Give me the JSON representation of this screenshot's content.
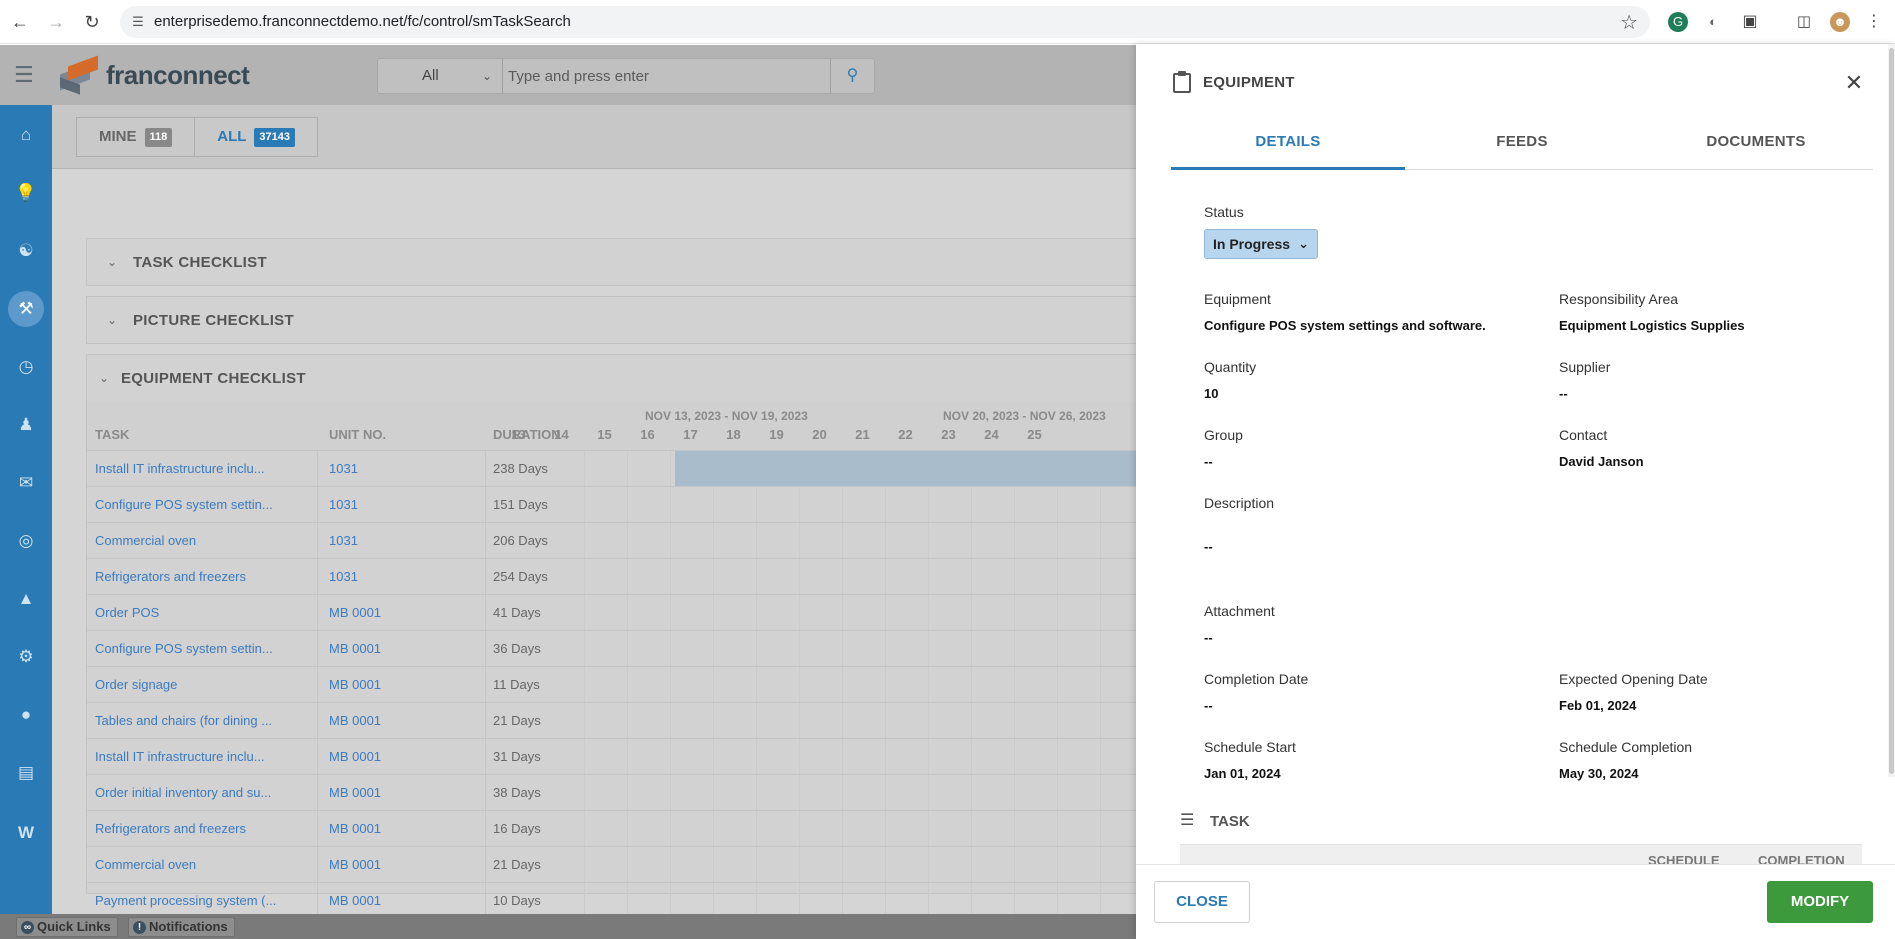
{
  "browser": {
    "url": "enterprisedemo.franconnectdemo.net/fc/control/smTaskSearch"
  },
  "app": {
    "logo_text": "franconnect",
    "search": {
      "scope": "All",
      "placeholder": "Type and press enter"
    },
    "filter_tabs": [
      {
        "label": "MINE",
        "count": "118"
      },
      {
        "label": "ALL",
        "count": "37143"
      }
    ],
    "sections": {
      "task_checklist": "TASK CHECKLIST",
      "picture_checklist": "PICTURE CHECKLIST",
      "equipment_checklist": "EQUIPMENT CHECKLIST"
    },
    "grid": {
      "columns": {
        "task": "TASK",
        "unit": "UNIT NO.",
        "duration": "DURATION"
      },
      "weeks": [
        "NOV 13, 2023 - NOV 19, 2023",
        "NOV 20, 2023 - NOV 26, 2023"
      ],
      "days": [
        "13",
        "14",
        "15",
        "16",
        "17",
        "18",
        "19",
        "20",
        "21",
        "22",
        "23",
        "24",
        "25"
      ],
      "rows": [
        {
          "task": "Install IT infrastructure inclu...",
          "unit": "1031",
          "duration": "238 Days"
        },
        {
          "task": "Configure POS system settin...",
          "unit": "1031",
          "duration": "151 Days"
        },
        {
          "task": "Commercial oven",
          "unit": "1031",
          "duration": "206 Days"
        },
        {
          "task": "Refrigerators and freezers",
          "unit": "1031",
          "duration": "254 Days"
        },
        {
          "task": "Order POS",
          "unit": "MB 0001",
          "duration": "41 Days"
        },
        {
          "task": "Configure POS system settin...",
          "unit": "MB 0001",
          "duration": "36 Days"
        },
        {
          "task": "Order signage",
          "unit": "MB 0001",
          "duration": "11 Days"
        },
        {
          "task": "Tables and chairs (for dining ...",
          "unit": "MB 0001",
          "duration": "21 Days"
        },
        {
          "task": "Install IT infrastructure inclu...",
          "unit": "MB 0001",
          "duration": "31 Days"
        },
        {
          "task": "Order initial inventory and su...",
          "unit": "MB 0001",
          "duration": "38 Days"
        },
        {
          "task": "Refrigerators and freezers",
          "unit": "MB 0001",
          "duration": "16 Days"
        },
        {
          "task": "Commercial oven",
          "unit": "MB 0001",
          "duration": "21 Days"
        },
        {
          "task": "Payment processing system (...",
          "unit": "MB 0001",
          "duration": "10 Days"
        }
      ]
    },
    "bottom": {
      "quick_links": "Quick Links",
      "notifications": "Notifications"
    }
  },
  "panel": {
    "title": "EQUIPMENT",
    "tabs": [
      "DETAILS",
      "FEEDS",
      "DOCUMENTS"
    ],
    "status_label": "Status",
    "status_value": "In Progress",
    "fields": {
      "equipment_label": "Equipment",
      "equipment_value": "Configure POS system settings and software.",
      "responsibility_label": "Responsibility Area",
      "responsibility_value": "Equipment Logistics Supplies",
      "quantity_label": "Quantity",
      "quantity_value": "10",
      "supplier_label": "Supplier",
      "supplier_value": "--",
      "group_label": "Group",
      "group_value": "--",
      "contact_label": "Contact",
      "contact_value": "David Janson",
      "description_label": "Description",
      "description_value": "--",
      "attachment_label": "Attachment",
      "attachment_value": "--",
      "completion_label": "Completion Date",
      "completion_value": "--",
      "opening_label": "Expected Opening Date",
      "opening_value": "Feb 01, 2024",
      "sched_start_label": "Schedule Start",
      "sched_start_value": "Jan 01, 2024",
      "sched_completion_label": "Schedule Completion",
      "sched_completion_value": "May 30, 2024"
    },
    "task_section": {
      "title": "TASK",
      "col_schedule": "SCHEDULE",
      "col_completion": "COMPLETION"
    },
    "buttons": {
      "close": "CLOSE",
      "modify": "MODIFY"
    }
  },
  "colors": {
    "brand_blue": "#2a7ab5",
    "modify_green": "#3c9a3c",
    "status_bg": "#b7d6ee"
  }
}
